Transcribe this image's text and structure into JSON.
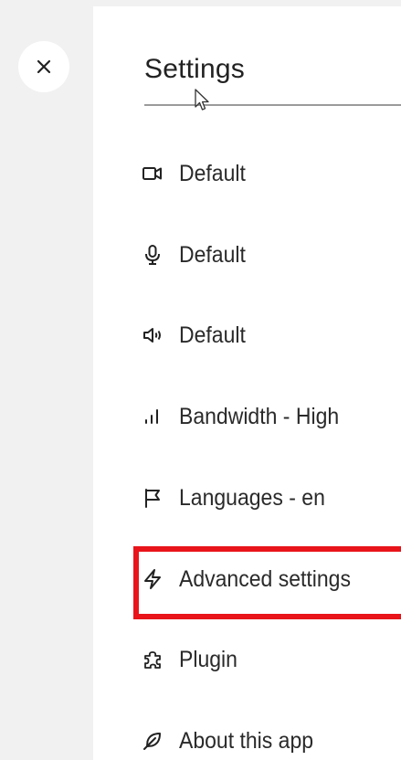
{
  "dialog": {
    "title": "Settings",
    "close_icon": "close-icon"
  },
  "menu": {
    "items": [
      {
        "icon": "video-camera-icon",
        "label": "Default"
      },
      {
        "icon": "microphone-icon",
        "label": "Default"
      },
      {
        "icon": "speaker-icon",
        "label": "Default"
      },
      {
        "icon": "signal-bars-icon",
        "label": "Bandwidth - High"
      },
      {
        "icon": "flag-icon",
        "label": "Languages - en"
      },
      {
        "icon": "lightning-icon",
        "label": "Advanced settings"
      },
      {
        "icon": "puzzle-icon",
        "label": "Plugin"
      },
      {
        "icon": "feather-icon",
        "label": "About this app"
      }
    ]
  },
  "highlight": {
    "color": "#e8141a",
    "target": "Advanced settings"
  },
  "colors": {
    "background": "#f1f1f1",
    "panel": "#ffffff",
    "text": "#2a2a2a"
  }
}
